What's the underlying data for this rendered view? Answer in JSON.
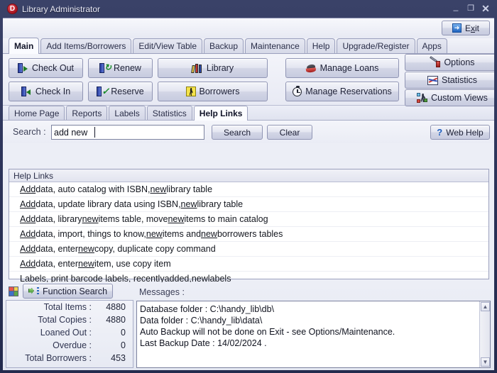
{
  "window": {
    "title": "Library Administrator",
    "icon": "D",
    "controls": {
      "minimize": "–",
      "maximize": "❐",
      "close": "✕"
    }
  },
  "exit": {
    "label_pre": "E",
    "label_accel": "x",
    "label_post": "it",
    "label": "Exit",
    "icon": "exit-arrow-icon"
  },
  "tabs": [
    {
      "label": "Main",
      "active": true
    },
    {
      "label": "Add Items/Borrowers",
      "active": false
    },
    {
      "label": "Edit/View Table",
      "active": false
    },
    {
      "label": "Backup",
      "active": false
    },
    {
      "label": "Maintenance",
      "active": false
    },
    {
      "label": "Help",
      "active": false
    },
    {
      "label": "Upgrade/Register",
      "active": false
    },
    {
      "label": "Apps",
      "active": false
    }
  ],
  "toolbar": {
    "check_out": "Check Out",
    "check_in": "Check In",
    "renew": "Renew",
    "reserve": "Reserve",
    "library": "Library",
    "borrowers": "Borrowers",
    "manage_loans": "Manage Loans",
    "manage_reservations": "Manage Reservations",
    "options": "Options",
    "statistics": "Statistics",
    "custom_views": "Custom Views"
  },
  "subtabs": [
    {
      "label": "Home Page",
      "active": false
    },
    {
      "label": "Reports",
      "active": false
    },
    {
      "label": "Labels",
      "active": false
    },
    {
      "label": "Statistics",
      "active": false
    },
    {
      "label": "Help Links",
      "active": true
    }
  ],
  "search": {
    "label": "Search :",
    "value": "add new",
    "placeholder": "",
    "search_button": "Search",
    "clear_button": "Clear",
    "web_help_button": "Web Help",
    "web_help_icon": "question-mark-icon"
  },
  "help_links": {
    "header": "Help Links",
    "rows": [
      [
        {
          "t": "Add",
          "u": true
        },
        {
          "t": " data, auto catalog with ISBN, ",
          "u": false
        },
        {
          "t": "new",
          "u": true
        },
        {
          "t": " library table",
          "u": false
        }
      ],
      [
        {
          "t": "Add",
          "u": true
        },
        {
          "t": " data, update library data using ISBN, ",
          "u": false
        },
        {
          "t": "new",
          "u": true
        },
        {
          "t": " library table",
          "u": false
        }
      ],
      [
        {
          "t": "Add",
          "u": true
        },
        {
          "t": " data, library ",
          "u": false
        },
        {
          "t": "new",
          "u": true
        },
        {
          "t": " items table, move ",
          "u": false
        },
        {
          "t": "new",
          "u": true
        },
        {
          "t": " items to main catalog",
          "u": false
        }
      ],
      [
        {
          "t": "Add",
          "u": true
        },
        {
          "t": " data, import, things to know, ",
          "u": false
        },
        {
          "t": "new",
          "u": true
        },
        {
          "t": " items and ",
          "u": false
        },
        {
          "t": "new",
          "u": true
        },
        {
          "t": " borrowers tables",
          "u": false
        }
      ],
      [
        {
          "t": "Add",
          "u": true
        },
        {
          "t": " data, enter ",
          "u": false
        },
        {
          "t": "new",
          "u": true
        },
        {
          "t": " copy, duplicate copy command",
          "u": false
        }
      ],
      [
        {
          "t": "Add",
          "u": true
        },
        {
          "t": " data, enter ",
          "u": false
        },
        {
          "t": "new",
          "u": true
        },
        {
          "t": " item, use copy item",
          "u": false
        }
      ],
      [
        {
          "t": "Labels, print barcode labels, recently ",
          "u": false
        },
        {
          "t": "added",
          "u": true
        },
        {
          "t": ", ",
          "u": false
        },
        {
          "t": "new",
          "u": true
        },
        {
          "t": " labels",
          "u": false
        }
      ]
    ]
  },
  "function_search": {
    "label": "Function Search",
    "icon": "function-search-icon",
    "grid_icon": "color-grid-icon"
  },
  "stats": {
    "rows": [
      {
        "label": "Total Items :",
        "value": "4880"
      },
      {
        "label": "Total Copies :",
        "value": "4880"
      },
      {
        "label": "Loaned Out :",
        "value": "0"
      },
      {
        "label": "Overdue :",
        "value": "0"
      },
      {
        "label": "Total Borrowers :",
        "value": "453"
      }
    ]
  },
  "messages": {
    "label": "Messages :",
    "text": "Database folder : C:\\handy_lib\\db\\\nData folder : C:\\handy_lib\\data\\\nAuto Backup will not be done on Exit - see Options/Maintenance.\nLast Backup Date : 14/02/2024 ."
  },
  "colors": {
    "title_bar": "#2a3157",
    "client_bg": "#eceef6",
    "accent_blue": "#1f63c0",
    "accent_red": "#a3111d",
    "list_bg": "#ffffff"
  }
}
